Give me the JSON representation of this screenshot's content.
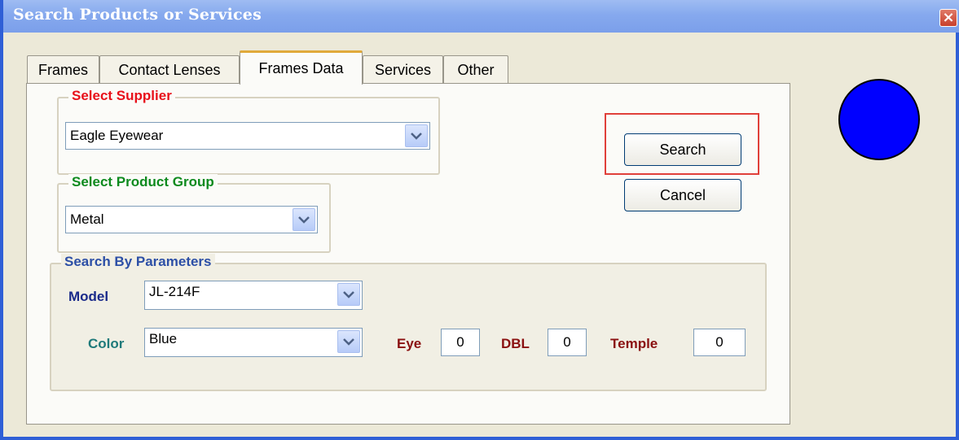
{
  "window": {
    "title": "Search Products or Services"
  },
  "tabs": [
    {
      "label": "Frames"
    },
    {
      "label": "Contact Lenses"
    },
    {
      "label": "Frames Data"
    },
    {
      "label": "Services"
    },
    {
      "label": "Other"
    }
  ],
  "active_tab": "Frames Data",
  "supplier": {
    "title": "Select Supplier",
    "value": "Eagle Eyewear"
  },
  "product_group": {
    "title": "Select Product Group",
    "value": "Metal"
  },
  "params": {
    "title": "Search By Parameters",
    "model_label": "Model",
    "model_value": "JL-214F",
    "color_label": "Color",
    "color_value": "Blue",
    "eye_label": "Eye",
    "eye_value": "0",
    "dbl_label": "DBL",
    "dbl_value": "0",
    "temple_label": "Temple",
    "temple_value": "0"
  },
  "buttons": {
    "search": "Search",
    "cancel": "Cancel"
  },
  "colors": {
    "supplier_title": "#e8101a",
    "product_group_title": "#0d8a1e",
    "params_title": "#2c4fa6",
    "model_label": "#1a2a8a",
    "color_label": "#1f7a7a",
    "measure_label": "#8a1010",
    "indicator": "#0000ff"
  }
}
